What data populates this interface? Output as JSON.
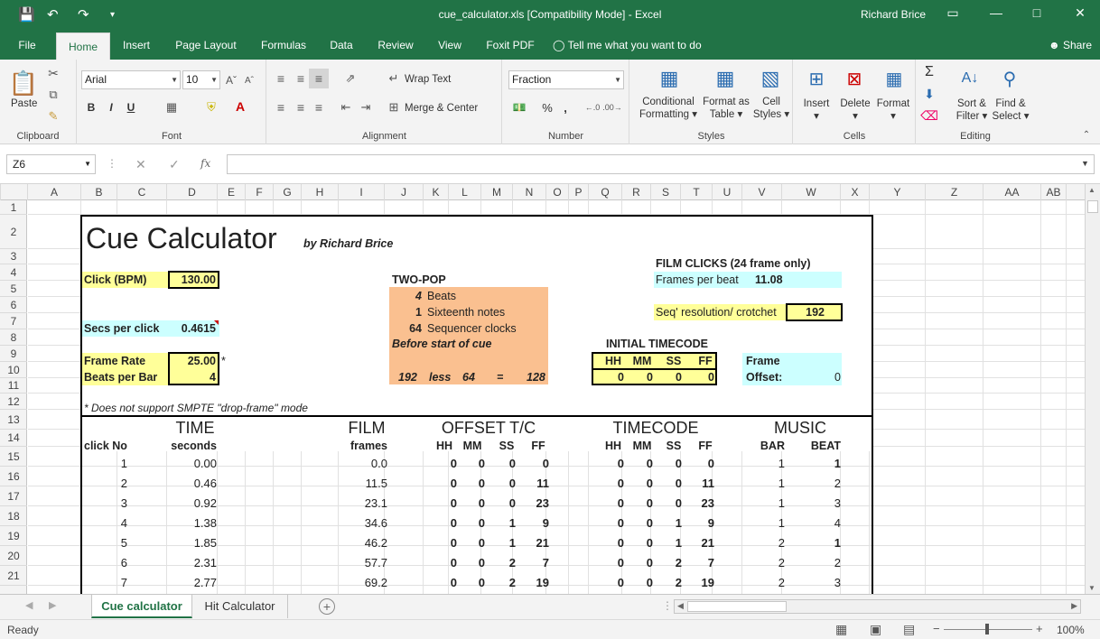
{
  "window": {
    "title": "cue_calculator.xls  [Compatibility Mode]  -  Excel",
    "user": "Richard Brice"
  },
  "ribbon_tabs": [
    "File",
    "Home",
    "Insert",
    "Page Layout",
    "Formulas",
    "Data",
    "Review",
    "View",
    "Foxit PDF"
  ],
  "tell_me": "Tell me what you want to do",
  "share": "Share",
  "ribbon": {
    "clipboard": {
      "label": "Clipboard",
      "paste": "Paste"
    },
    "font": {
      "label": "Font",
      "name": "Arial",
      "size": "10",
      "bold": "B",
      "italic": "I",
      "underline": "U"
    },
    "alignment": {
      "label": "Alignment",
      "wrap": "Wrap Text",
      "merge": "Merge & Center"
    },
    "number": {
      "label": "Number",
      "format": "Fraction",
      "percent": "%",
      "comma": ","
    },
    "styles": {
      "label": "Styles",
      "cond1": "Conditional",
      "cond2": "Formatting",
      "fmt1": "Format as",
      "fmt2": "Table",
      "cell1": "Cell",
      "cell2": "Styles"
    },
    "cells": {
      "label": "Cells",
      "insert": "Insert",
      "delete": "Delete",
      "format": "Format"
    },
    "editing": {
      "label": "Editing",
      "sort1": "Sort &",
      "sort2": "Filter",
      "find1": "Find &",
      "find2": "Select"
    }
  },
  "formula_bar": {
    "namebox": "Z6",
    "fx": "fx",
    "value": ""
  },
  "columns": [
    "A",
    "B",
    "C",
    "D",
    "E",
    "F",
    "G",
    "H",
    "I",
    "J",
    "K",
    "L",
    "M",
    "N",
    "O",
    "P",
    "Q",
    "R",
    "S",
    "T",
    "U",
    "V",
    "W",
    "X",
    "Y",
    "Z",
    "AA",
    "AB"
  ],
  "rows": [
    "1",
    "2",
    "3",
    "4",
    "5",
    "6",
    "7",
    "8",
    "9",
    "10",
    "11",
    "12",
    "13",
    "14",
    "15",
    "16",
    "17",
    "18",
    "19",
    "20",
    "21"
  ],
  "sheet": {
    "title": "Cue Calculator",
    "byline": "by Richard Brice",
    "click_label": "Click (BPM)",
    "click_value": "130.00",
    "secs_label": "Secs per click",
    "secs_value": "0.4615",
    "framerate_label": "Frame Rate",
    "framerate_value": "25.00",
    "asterisk": "*",
    "beatsbar_label": "Beats per Bar",
    "beatsbar_value": "4",
    "note": "* Does not support SMPTE \"drop-frame\" mode",
    "twopop": {
      "title": "TWO-POP",
      "beats_n": "4",
      "beats": "Beats",
      "sixteenth_n": "1",
      "sixteenth": "Sixteenth notes",
      "seq_n": "64",
      "seq": "Sequencer clocks",
      "before": "Before start of cue",
      "f1": "192",
      "less": "less",
      "f2": "64",
      "eq": "=",
      "f3": "128"
    },
    "film_clicks": {
      "title": "FILM CLICKS (24 frame only)",
      "fpb_label": "Frames per beat",
      "fpb_value": "11.08",
      "seqres_label": "Seq' resolution/ crotchet",
      "seqres_value": "192"
    },
    "initial_tc": {
      "title": "INITIAL TIMECODE",
      "headers": [
        "HH",
        "MM",
        "SS",
        "FF"
      ],
      "values": [
        "0",
        "0",
        "0",
        "0"
      ]
    },
    "frame_offset": {
      "frame": "Frame",
      "offset": "Offset:",
      "value": "0"
    },
    "sections": {
      "time": "TIME",
      "film": "FILM",
      "offset": "OFFSET T/C",
      "timecode": "TIMECODE",
      "music": "MUSIC"
    },
    "sub": {
      "clickno": "click No",
      "seconds": "seconds",
      "frames": "frames",
      "hh": "HH",
      "mm": "MM",
      "ss": "SS",
      "ff": "FF",
      "bar": "BAR",
      "beat": "BEAT"
    },
    "table": [
      {
        "n": "1",
        "sec": "0.00",
        "fr": "0.0",
        "o": [
          "0",
          "0",
          "0",
          "0"
        ],
        "t": [
          "0",
          "0",
          "0",
          "0"
        ],
        "bar": "1",
        "beat": "1"
      },
      {
        "n": "2",
        "sec": "0.46",
        "fr": "11.5",
        "o": [
          "0",
          "0",
          "0",
          "11"
        ],
        "t": [
          "0",
          "0",
          "0",
          "11"
        ],
        "bar": "1",
        "beat": "2"
      },
      {
        "n": "3",
        "sec": "0.92",
        "fr": "23.1",
        "o": [
          "0",
          "0",
          "0",
          "23"
        ],
        "t": [
          "0",
          "0",
          "0",
          "23"
        ],
        "bar": "1",
        "beat": "3"
      },
      {
        "n": "4",
        "sec": "1.38",
        "fr": "34.6",
        "o": [
          "0",
          "0",
          "1",
          "9"
        ],
        "t": [
          "0",
          "0",
          "1",
          "9"
        ],
        "bar": "1",
        "beat": "4"
      },
      {
        "n": "5",
        "sec": "1.85",
        "fr": "46.2",
        "o": [
          "0",
          "0",
          "1",
          "21"
        ],
        "t": [
          "0",
          "0",
          "1",
          "21"
        ],
        "bar": "2",
        "beat": "1"
      },
      {
        "n": "6",
        "sec": "2.31",
        "fr": "57.7",
        "o": [
          "0",
          "0",
          "2",
          "7"
        ],
        "t": [
          "0",
          "0",
          "2",
          "7"
        ],
        "bar": "2",
        "beat": "2"
      },
      {
        "n": "7",
        "sec": "2.77",
        "fr": "69.2",
        "o": [
          "0",
          "0",
          "2",
          "19"
        ],
        "t": [
          "0",
          "0",
          "2",
          "19"
        ],
        "bar": "2",
        "beat": "3"
      }
    ]
  },
  "sheet_tabs": [
    "Cue calculator",
    "Hit Calculator"
  ],
  "status": {
    "ready": "Ready",
    "zoom": "100%"
  },
  "colors": {
    "excel_green": "#217346",
    "yellow": "#ffff99",
    "cyan": "#ccffff",
    "orange": "#fac090"
  }
}
